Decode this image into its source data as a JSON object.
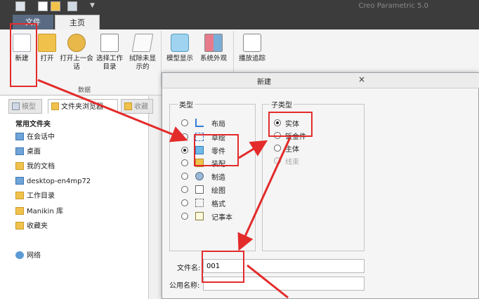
{
  "app": {
    "title": "Creo Parametric 5.0"
  },
  "ribbon": {
    "tabs": [
      "文件",
      "主页"
    ],
    "buttons": [
      {
        "label": "新建",
        "icon": "new-file-icon"
      },
      {
        "label": "打开",
        "icon": "open-folder-icon"
      },
      {
        "label": "打开上一会话",
        "icon": "open-last-session-icon"
      },
      {
        "label": "选择工作目录",
        "icon": "working-directory-icon"
      },
      {
        "label": "拭除未显示的",
        "icon": "erase-not-displayed-icon"
      },
      {
        "label": "模型显示",
        "icon": "model-display-icon"
      },
      {
        "label": "系统外观",
        "icon": "system-appearance-icon"
      },
      {
        "label": "播放追踪",
        "icon": "play-trail-icon"
      }
    ],
    "group_label": "数据"
  },
  "navigator": {
    "tabs": [
      "模型",
      "文件夹浏览器",
      "收藏"
    ],
    "heading": "常用文件夹",
    "items": [
      {
        "label": "在会话中",
        "icon": "session-icon"
      },
      {
        "label": "桌面",
        "icon": "desktop-icon"
      },
      {
        "label": "我的文档",
        "icon": "documents-icon"
      },
      {
        "label": "desktop-en4mp72",
        "icon": "computer-icon"
      },
      {
        "label": "工作目录",
        "icon": "folder-icon"
      },
      {
        "label": "Manikin 库",
        "icon": "folder-icon"
      },
      {
        "label": "收藏夹",
        "icon": "favorites-icon"
      },
      {
        "label": "网络",
        "icon": "network-icon"
      }
    ]
  },
  "dialog": {
    "title": "新建",
    "close_glyph": "×",
    "type_legend": "类型",
    "types": [
      {
        "label": "布局",
        "selected": false
      },
      {
        "label": "草绘",
        "selected": false
      },
      {
        "label": "零件",
        "selected": true
      },
      {
        "label": "装配",
        "selected": false
      },
      {
        "label": "制造",
        "selected": false
      },
      {
        "label": "绘图",
        "selected": false
      },
      {
        "label": "格式",
        "selected": false
      },
      {
        "label": "记事本",
        "selected": false
      }
    ],
    "subtype_legend": "子类型",
    "subtypes": [
      {
        "label": "实体",
        "selected": true,
        "enabled": true
      },
      {
        "label": "钣金件",
        "selected": false,
        "enabled": true
      },
      {
        "label": "主体",
        "selected": false,
        "enabled": true
      },
      {
        "label": "线束",
        "selected": false,
        "enabled": false
      }
    ],
    "filename_label": "文件名:",
    "filename_value": "001",
    "common_name_label": "公用名称:",
    "common_name_value": ""
  },
  "colors": {
    "annotation": "#e32b2b",
    "file_tab": "#5a6a82",
    "titlebar": "#3c3c3c"
  }
}
